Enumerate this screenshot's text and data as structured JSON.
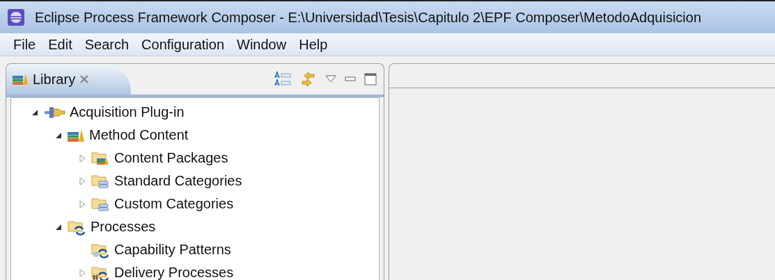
{
  "window": {
    "title": "Eclipse Process Framework Composer - E:\\Universidad\\Tesis\\Capitulo 2\\EPF Composer\\MetodoAdquisicion"
  },
  "menu": [
    "File",
    "Edit",
    "Search",
    "Configuration",
    "Window",
    "Help"
  ],
  "library_view": {
    "tab": {
      "label": "Library",
      "selected": true
    },
    "tree": [
      {
        "label": "Acquisition Plug-in",
        "kind": "plugin",
        "expanded": true,
        "children": [
          {
            "label": "Method Content",
            "kind": "content",
            "expanded": true,
            "children": [
              {
                "label": "Content Packages",
                "kind": "package",
                "expanded": false
              },
              {
                "label": "Standard Categories",
                "kind": "category",
                "expanded": false
              },
              {
                "label": "Custom Categories",
                "kind": "category",
                "expanded": false
              }
            ]
          },
          {
            "label": "Processes",
            "kind": "processes",
            "expanded": true,
            "children": [
              {
                "label": "Capability Patterns",
                "kind": "capability"
              },
              {
                "label": "Delivery Processes",
                "kind": "delivery",
                "expanded": false
              }
            ]
          }
        ]
      }
    ]
  }
}
